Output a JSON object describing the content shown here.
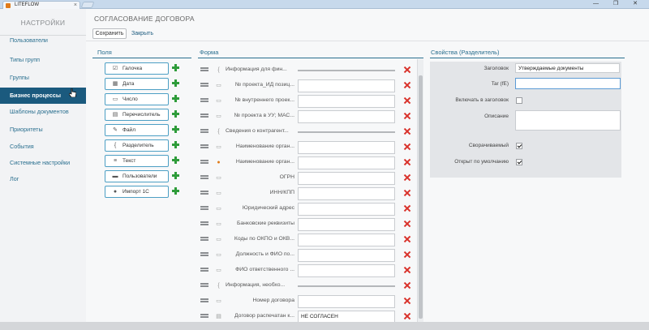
{
  "browser": {
    "tab_title": "LITEFLOW",
    "tab_close": "×",
    "window_controls": "— ❐ ✕"
  },
  "sidebar": {
    "title": "НАСТРОЙКИ",
    "items": [
      {
        "label": "Пользователи",
        "active": false
      },
      {
        "label": "Типы групп",
        "active": false
      },
      {
        "label": "Группы",
        "active": false
      },
      {
        "label": "Бизнес процессы",
        "active": true
      },
      {
        "label": "Шаблоны документов",
        "active": false
      },
      {
        "label": "Приоритеты",
        "active": false
      },
      {
        "label": "События",
        "active": false
      },
      {
        "label": "Системные настройки",
        "active": false
      },
      {
        "label": "Лог",
        "active": false
      }
    ]
  },
  "main": {
    "title": "СОГЛАСОВАНИЕ ДОГОВОРА",
    "toolbar": {
      "save_label": "Сохранить",
      "close_label": "Закрыть"
    }
  },
  "fields": {
    "heading": "Поля",
    "items": [
      {
        "label": "Галочка",
        "icon": "☑"
      },
      {
        "label": "Дата",
        "icon": "▦"
      },
      {
        "label": "Число",
        "icon": "▭"
      },
      {
        "label": "Перечислитель",
        "icon": "▤"
      },
      {
        "label": "Файл",
        "icon": "✎"
      },
      {
        "label": "Разделитель",
        "icon": "{"
      },
      {
        "label": "Текст",
        "icon": "≡"
      },
      {
        "label": "Пользователи",
        "icon": "▬"
      },
      {
        "label": "Импорт 1С",
        "icon": "●"
      }
    ]
  },
  "form": {
    "heading": "Форма",
    "rows": [
      {
        "label": "Информация для фин...",
        "type": "separator",
        "value": ""
      },
      {
        "label": "№ проекта_ИД позиц...",
        "type": "text",
        "value": ""
      },
      {
        "label": "№ внутреннего проек...",
        "type": "text",
        "value": ""
      },
      {
        "label": "№ проекта в УУ; МАС...",
        "type": "text",
        "value": ""
      },
      {
        "label": "Сведения о контрагент...",
        "type": "separator",
        "value": ""
      },
      {
        "label": "Наименование орган...",
        "type": "text",
        "value": ""
      },
      {
        "label": "Наименование орган...",
        "type": "import",
        "value": ""
      },
      {
        "label": "ОГРН",
        "type": "text",
        "value": ""
      },
      {
        "label": "ИНН/КПП",
        "type": "text",
        "value": ""
      },
      {
        "label": "Юридический адрес",
        "type": "text",
        "value": ""
      },
      {
        "label": "Банковские реквизиты",
        "type": "text",
        "value": ""
      },
      {
        "label": "Коды по ОКПО и ОКВ...",
        "type": "text",
        "value": ""
      },
      {
        "label": "Должность и ФИО по...",
        "type": "text",
        "value": ""
      },
      {
        "label": "ФИО ответственного ...",
        "type": "text",
        "value": ""
      },
      {
        "label": "Информация, необхо...",
        "type": "separator",
        "value": ""
      },
      {
        "label": "Номер договора",
        "type": "text",
        "value": ""
      },
      {
        "label": "Договор распечатан к...",
        "type": "enum",
        "value": "НЕ СОГЛАСЕН"
      }
    ]
  },
  "properties": {
    "heading": "Свойства (Разделитель)",
    "title_label": "Заголовок",
    "title_value": "Утверждаемые документы",
    "tag_label": "Tar (fE)",
    "tag_value": "",
    "include_label": "Включать в заголовок",
    "include_checked": false,
    "description_label": "Описание",
    "description_value": "",
    "collapsible_label": "Сворачиваемый",
    "collapsible_checked": true,
    "open_default_label": "Открыт по умолчанию",
    "open_default_checked": true
  }
}
